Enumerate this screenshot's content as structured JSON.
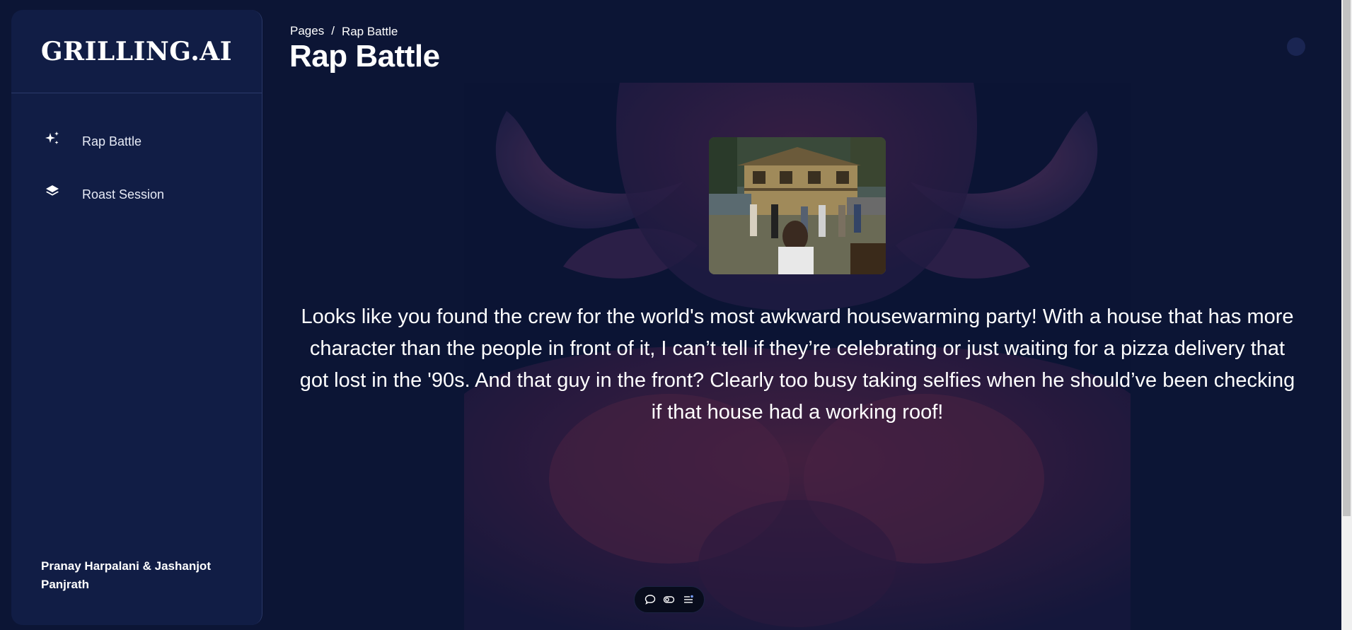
{
  "brand": {
    "name": "GRILLING.AI"
  },
  "sidebar": {
    "items": [
      {
        "label": "Rap Battle",
        "icon": "sparkles-icon"
      },
      {
        "label": "Roast Session",
        "icon": "layers-icon"
      }
    ],
    "footer": "Pranay Harpalani & Jashanjot Panjrath"
  },
  "breadcrumb": {
    "root": "Pages",
    "separator": "/",
    "current": "Rap Battle"
  },
  "page": {
    "title": "Rap Battle"
  },
  "roast": {
    "text": "Looks like you found the crew for the world's most awkward housewarming party! With a house that has more character than the people in front of it, I can’t tell if they’re celebrating or just waiting for a pizza delivery that got lost in the '90s. And that guy in the front? Clearly too busy taking selfies when he should’ve been checking if that house had a working roof!"
  },
  "toolbar": {
    "buttons": [
      "chat-bubble-icon",
      "toggle-icon",
      "list-settings-icon"
    ]
  },
  "colors": {
    "background": "#0c1535",
    "sidebar": "#111d45",
    "bull_accent": "#7a2a4c"
  }
}
